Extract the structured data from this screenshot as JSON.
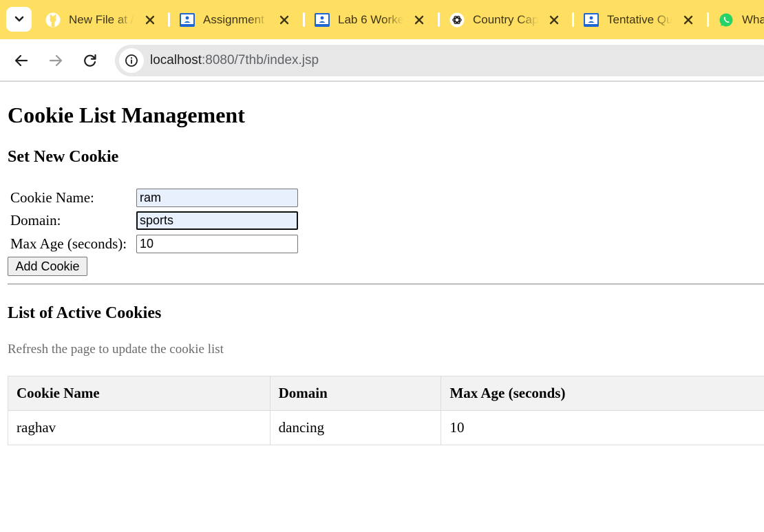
{
  "browser": {
    "tabs": [
      {
        "title": "New File at /",
        "icon": "github-icon"
      },
      {
        "title": "Assignment I",
        "icon": "classroom-icon"
      },
      {
        "title": "Lab 6 Worked",
        "icon": "classroom-icon"
      },
      {
        "title": "Country Capi",
        "icon": "chatgpt-icon"
      },
      {
        "title": "Tentative Que",
        "icon": "classroom-icon"
      },
      {
        "title": "Wha",
        "icon": "whatsapp-icon"
      }
    ],
    "url_host": "localhost",
    "url_path": ":8080/7thb/index.jsp",
    "colors": {
      "tabbar": "#ffdf61",
      "omnibox": "#e7e7e7"
    }
  },
  "page": {
    "title": "Cookie List Management",
    "form": {
      "heading": "Set New Cookie",
      "name_label": "Cookie Name:",
      "name_value": "ram",
      "domain_label": "Domain:",
      "domain_value": "sports",
      "max_age_label": "Max Age (seconds):",
      "max_age_value": "10",
      "submit_label": "Add Cookie"
    },
    "list": {
      "heading": "List of Active Cookies",
      "hint": "Refresh the page to update the cookie list",
      "columns": [
        "Cookie Name",
        "Domain",
        "Max Age (seconds)"
      ],
      "rows": [
        [
          "raghav",
          "dancing",
          "10"
        ]
      ]
    }
  }
}
